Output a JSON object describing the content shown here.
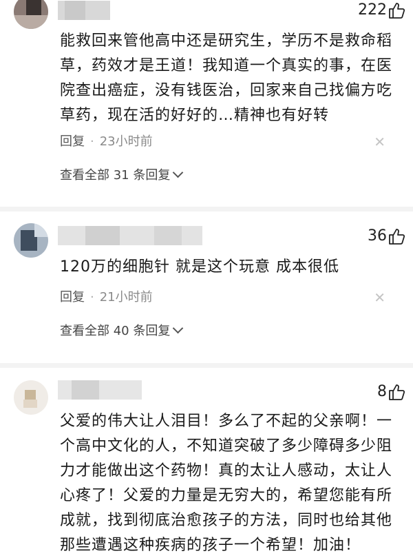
{
  "comments": [
    {
      "likes": "222",
      "text": "能救回来管他高中还是研究生，学历不是救命稻草，药效才是王道！我知道一个真实的事，在医院查出癌症，没有钱医治，回家来自己找偏方吃草药，现在活的好好的…精神也有好转",
      "reply_label": "回复",
      "separator": "·",
      "time": "23小时前",
      "view_replies": "查看全部 31 条回复"
    },
    {
      "likes": "36",
      "text": "120万的细胞针 就是这个玩意 成本很低",
      "reply_label": "回复",
      "separator": "·",
      "time": "21小时前",
      "view_replies": "查看全部 40 条回复"
    },
    {
      "likes": "8",
      "text": "父爱的伟大让人泪目！多么了不起的父亲啊！一个高中文化的人，不知道突破了多少障碍多少阻力才能做出这个药物！真的太让人感动，太让人心疼了！父爱的力量是无穷大的，希望您能有所成就，找到彻底治愈孩子的方法，同时也给其他那些遭遇这种疾病的孩子一个希望！加油！"
    }
  ],
  "icons": {
    "like": "thumbs-up-icon",
    "close": "close-icon",
    "expand": "chevron-down-icon"
  }
}
